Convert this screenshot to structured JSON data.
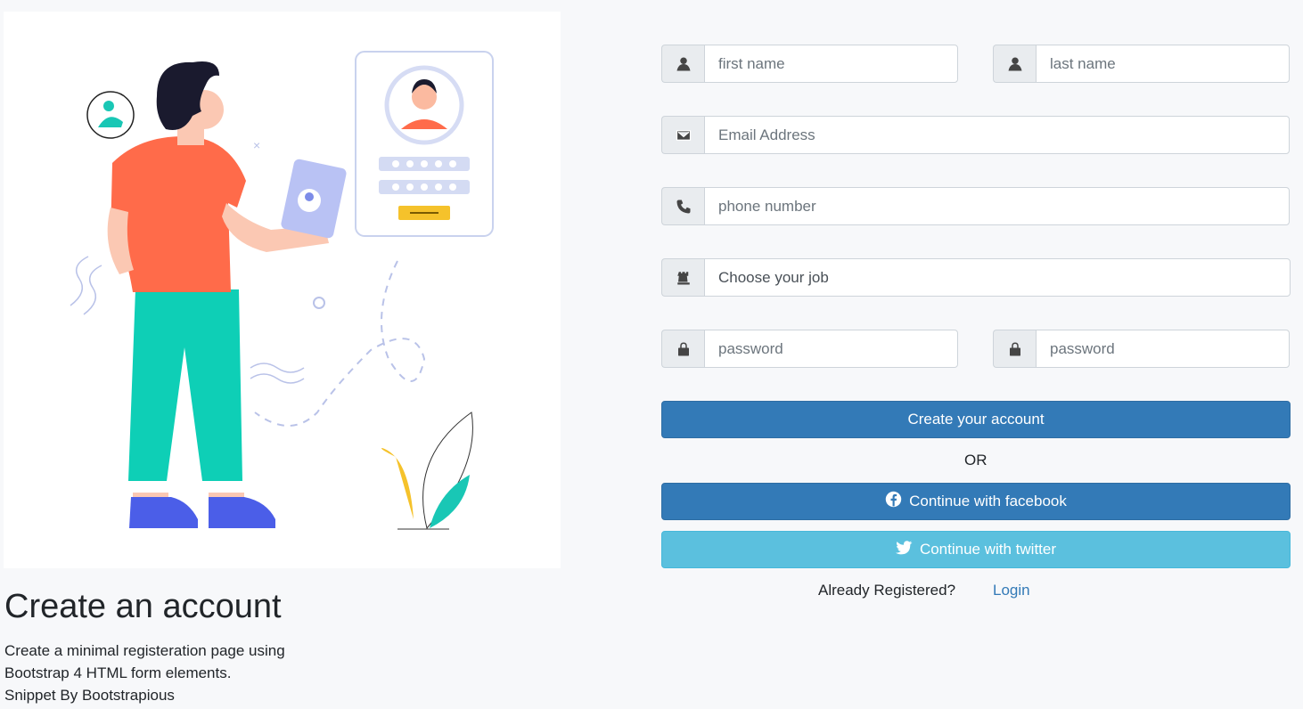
{
  "intro": {
    "title": "Create an account",
    "description_lines": [
      "Create a minimal registeration page using",
      "Bootstrap 4 HTML form elements.",
      "Snippet By Bootstrapious"
    ]
  },
  "form": {
    "first_name": {
      "placeholder": "first name",
      "icon": "user-icon"
    },
    "last_name": {
      "placeholder": "last name",
      "icon": "user-icon"
    },
    "email": {
      "placeholder": "Email Address",
      "icon": "envelope-icon"
    },
    "phone": {
      "placeholder": "phone number",
      "icon": "phone-icon"
    },
    "job": {
      "selected": "Choose your job",
      "icon": "chess-rook-icon"
    },
    "password": {
      "placeholder": "password",
      "icon": "lock-icon"
    },
    "confirm_password": {
      "placeholder": "password",
      "icon": "lock-icon"
    },
    "submit_label": "Create your account",
    "divider_label": "OR",
    "facebook_label": "Continue with facebook",
    "twitter_label": "Continue with twitter",
    "already_registered": "Already Registered?",
    "login_label": "Login"
  },
  "colors": {
    "primary": "#337ab7",
    "info": "#5bc0de",
    "page_background": "#f7f8fa"
  }
}
